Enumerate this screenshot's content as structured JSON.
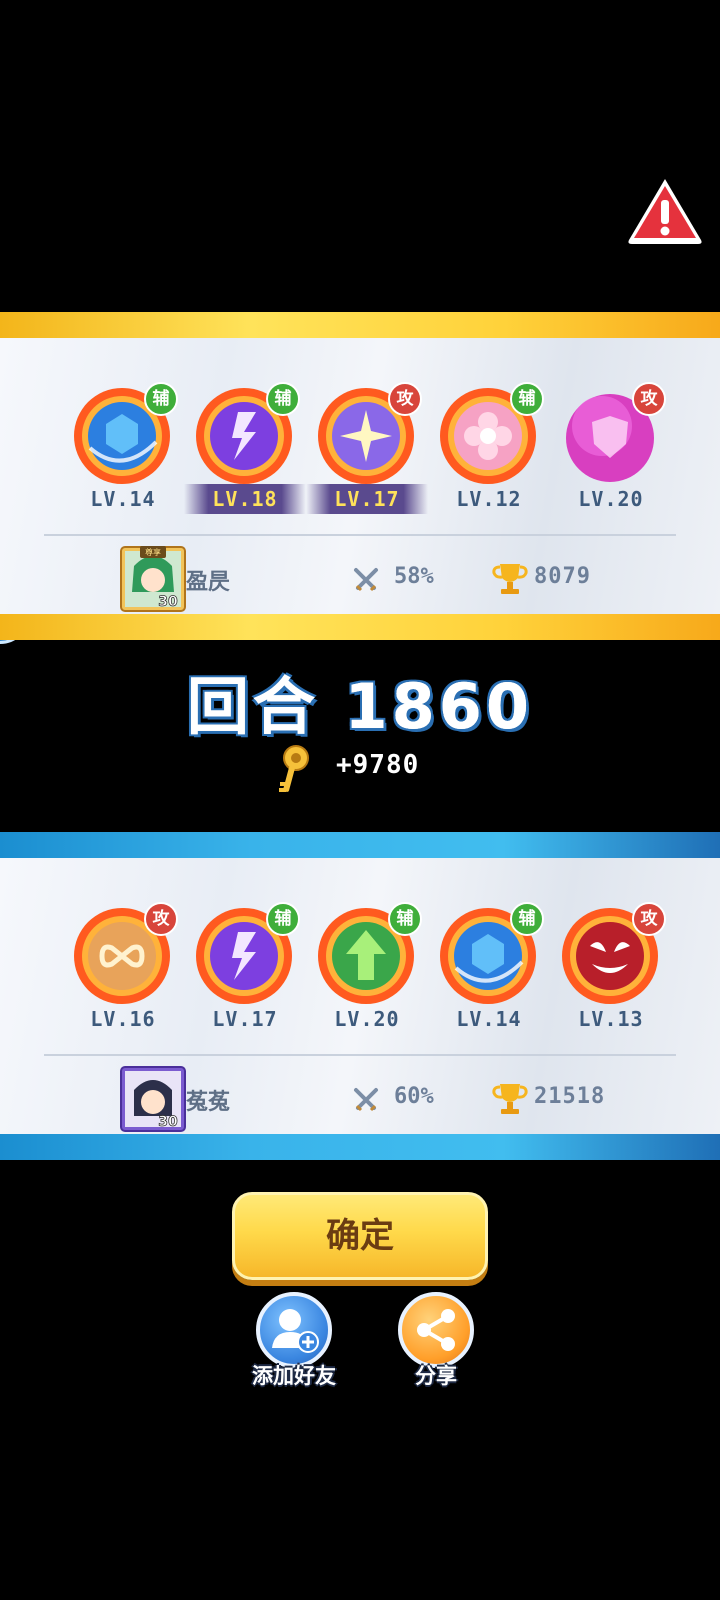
{
  "round_label": "回合 1860",
  "reward_text": "+9780",
  "confirm_label": "确定",
  "add_friend_label": "添加好友",
  "share_label": "分享",
  "tag_support": "辅",
  "tag_attack": "攻",
  "team_top": {
    "player_name": "盈昃",
    "avatar_level": "30",
    "avatar_badge": "尊享",
    "win_rate": "58%",
    "trophies": "8079",
    "orbs": [
      {
        "level": "LV.14",
        "tag": "辅",
        "icon": "blue-hex-orb-icon"
      },
      {
        "level": "LV.18",
        "tag": "辅",
        "icon": "purple-lightning-orb-icon",
        "highlight": true
      },
      {
        "level": "LV.17",
        "tag": "攻",
        "icon": "sparkle-star-orb-icon",
        "highlight": true
      },
      {
        "level": "LV.12",
        "tag": "辅",
        "icon": "pink-flower-orb-icon"
      },
      {
        "level": "LV.20",
        "tag": "攻",
        "icon": "pink-shield-bubble-icon"
      }
    ]
  },
  "team_bottom": {
    "player_name": "菟菟",
    "avatar_level": "30",
    "win_rate": "60%",
    "trophies": "21518",
    "orbs": [
      {
        "level": "LV.16",
        "tag": "攻",
        "icon": "infinity-orb-icon"
      },
      {
        "level": "LV.17",
        "tag": "辅",
        "icon": "purple-lightning-orb-icon"
      },
      {
        "level": "LV.20",
        "tag": "辅",
        "icon": "green-arrow-orb-icon"
      },
      {
        "level": "LV.14",
        "tag": "辅",
        "icon": "blue-hex-orb-icon"
      },
      {
        "level": "LV.13",
        "tag": "攻",
        "icon": "venom-face-orb-icon"
      }
    ]
  },
  "colors": {
    "win_bar": "#ffd23a",
    "lose_bar": "#39b3ea",
    "support_tag": "#3fae3a",
    "attack_tag": "#d8453b",
    "confirm_button": "#ffd94a"
  }
}
